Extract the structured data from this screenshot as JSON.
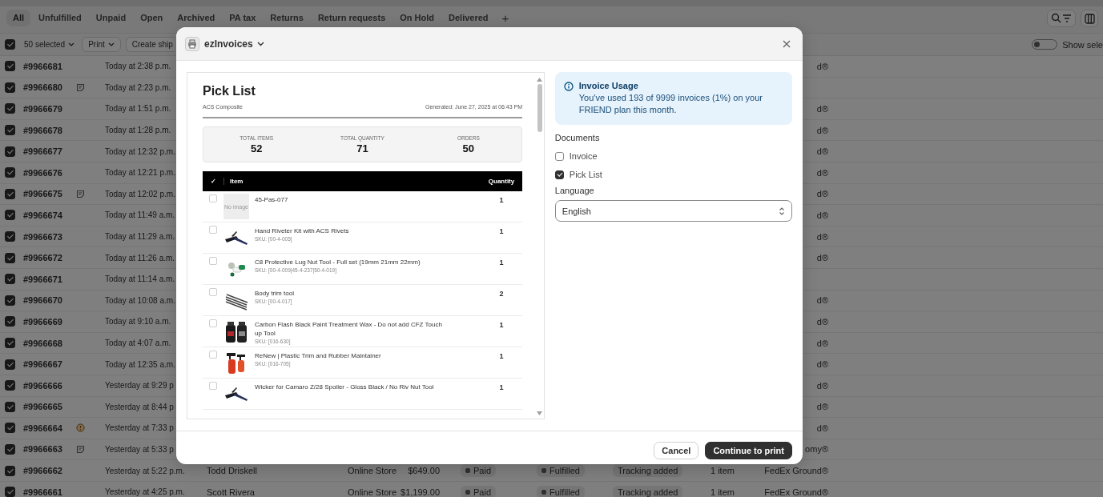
{
  "tabs": [
    {
      "label": "All",
      "selected": true
    },
    {
      "label": "Unfulfilled",
      "selected": false
    },
    {
      "label": "Unpaid",
      "selected": false
    },
    {
      "label": "Open",
      "selected": false
    },
    {
      "label": "Archived",
      "selected": false
    },
    {
      "label": "PA tax",
      "selected": false
    },
    {
      "label": "Returns",
      "selected": false
    },
    {
      "label": "Return requests",
      "selected": false
    },
    {
      "label": "On Hold",
      "selected": false
    },
    {
      "label": "Delivered",
      "selected": false
    }
  ],
  "add_tab": "+",
  "bulk_bar": {
    "checked": true,
    "selected_count": "50 selected",
    "print": "Print",
    "create": "Create ship",
    "toggle_label": "Show sele",
    "toggle_on": false
  },
  "orders": [
    {
      "kind": "plain",
      "selected": true,
      "number": "#9966681",
      "date": "Today at 2:38 p.m.",
      "shipping": "d®"
    },
    {
      "kind": "note",
      "selected": true,
      "number": "#9966680",
      "date": "Today at 2:23 p.m."
    },
    {
      "kind": "plain",
      "selected": true,
      "number": "#9966679",
      "date": "Today at 1:51 p.m.",
      "shipping": "d®"
    },
    {
      "kind": "plain",
      "selected": true,
      "number": "#9966678",
      "date": "Today at 1:28 p.m.",
      "shipping": "d®"
    },
    {
      "kind": "plain",
      "selected": true,
      "number": "#9966677",
      "date": "Today at 12:32 p.m.",
      "shipping": "d®"
    },
    {
      "kind": "plain",
      "selected": true,
      "number": "#9966676",
      "date": "Today at 12:21 p.m.",
      "shipping": "d®"
    },
    {
      "kind": "note",
      "selected": true,
      "number": "#9966675",
      "date": "Today at 12:02 p.m.",
      "shipping": "d®"
    },
    {
      "kind": "plain",
      "selected": true,
      "number": "#9966674",
      "date": "Today at 11:49 a.m.",
      "shipping": "d®"
    },
    {
      "kind": "plain",
      "selected": true,
      "number": "#9966673",
      "date": "Today at 11:29 a.m.",
      "shipping": "d®"
    },
    {
      "kind": "plain",
      "selected": true,
      "number": "#9966672",
      "date": "Today at 11:26 a.m.",
      "shipping": "d®"
    },
    {
      "kind": "plain",
      "selected": true,
      "number": "#9966671",
      "date": "Today at 11:14 a.m."
    },
    {
      "kind": "plain",
      "selected": true,
      "number": "#9966670",
      "date": "Today at 10:08 a.m.",
      "shipping": "d®"
    },
    {
      "kind": "plain",
      "selected": true,
      "number": "#9966669",
      "date": "Today at 9:10 a.m.",
      "shipping": "d®"
    },
    {
      "kind": "plain",
      "selected": true,
      "number": "#9966668",
      "date": "Today at 4:07 a.m.",
      "shipping": "d®"
    },
    {
      "kind": "plain",
      "selected": true,
      "number": "#9966667",
      "date": "Today at 12:35 a.m.",
      "shipping": "d®"
    },
    {
      "kind": "plain",
      "selected": true,
      "number": "#9966666",
      "date": "Yesterday at 9:29 p",
      "shipping": "d®"
    },
    {
      "kind": "plain",
      "selected": true,
      "number": "#9966665",
      "date": "Yesterday at 8:44 p",
      "shipping": "d®"
    },
    {
      "kind": "alert",
      "selected": true,
      "number": "#9966664",
      "date": "Yesterday at 7:33 p",
      "shipping": "d®"
    },
    {
      "kind": "note",
      "selected": true,
      "number": "#9966663",
      "date": "Yesterday at 5:33 p",
      "shipping": "omy®"
    },
    {
      "kind": "plain",
      "selected": true,
      "number": "#9966662",
      "date": "Yesterday at 5:22 p.m.",
      "customer": "Todd Driskell",
      "channel": "Online Store",
      "total": "$649.00",
      "payment": "Paid",
      "fulfillment": "Fulfilled",
      "delivery": "Tracking added",
      "items": "1 item",
      "shipping": "FedEx Ground®"
    },
    {
      "kind": "plain",
      "selected": true,
      "number": "#9966661",
      "date": "Yesterday at 4:25 p.m.",
      "customer": "Scott Rivera",
      "channel": "Online Store",
      "total": "$1,199.00",
      "payment": "Paid",
      "fulfillment": "Fulfilled",
      "delivery": "Tracking added",
      "items": "1 item",
      "shipping": "FedEx Ground®"
    }
  ],
  "modal": {
    "app_name": "ezInvoices",
    "preview": {
      "title": "Pick List",
      "store": "ACS Composite",
      "generated": "Generated: June 27, 2025 at 06:43 PM",
      "stats": [
        {
          "label": "TOTAL ITEMS",
          "value": "52"
        },
        {
          "label": "TOTAL QUANTITY",
          "value": "71"
        },
        {
          "label": "ORDERS",
          "value": "50"
        }
      ],
      "columns": {
        "check": "✓",
        "item": "Item",
        "quantity": "Quantity"
      },
      "items": [
        {
          "kind": "placeholder",
          "checked": false,
          "no_image": "No image",
          "name": "45-Pas-077",
          "quantity": "1"
        },
        {
          "kind": "picture",
          "checked": false,
          "name": "Hand Riveter Kit with ACS Rivets",
          "sku": "SKU: [00-4-005]",
          "quantity": "1"
        },
        {
          "kind": "picture",
          "checked": false,
          "name": "C8 Protective Lug Nut Tool - Full set (19mm 21mm 22mm)",
          "sku": "SKU: [00-4-009|45-4-237|50-4-019]",
          "quantity": "1"
        },
        {
          "kind": "picture",
          "checked": false,
          "name": "Body trim tool",
          "sku": "SKU: [00-4-017]",
          "quantity": "2"
        },
        {
          "kind": "picture",
          "checked": false,
          "name": "Carbon Flash Black Paint Treatment Wax - Do not add CFZ Touch up Tool",
          "sku": "SKU: [016-630]",
          "quantity": "1"
        },
        {
          "kind": "picture",
          "checked": false,
          "name": "ReNew | Plastic Trim and Rubber Maintainer",
          "sku": "SKU: [016-705]",
          "quantity": "1"
        },
        {
          "kind": "picture",
          "checked": false,
          "name": "Wicker for Camaro Z/28 Spoiler - Gloss Black / No Riv Nut Tool",
          "quantity": "1"
        }
      ]
    },
    "usage": {
      "title": "Invoice Usage",
      "text": "You've used 193 of 9999 invoices (1%) on your FRIEND plan this month."
    },
    "documents_label": "Documents",
    "documents": [
      {
        "label": "Invoice",
        "checked": false
      },
      {
        "label": "Pick List",
        "checked": true
      }
    ],
    "language_label": "Language",
    "language": "English",
    "cancel": "Cancel",
    "confirm": "Continue to print"
  }
}
